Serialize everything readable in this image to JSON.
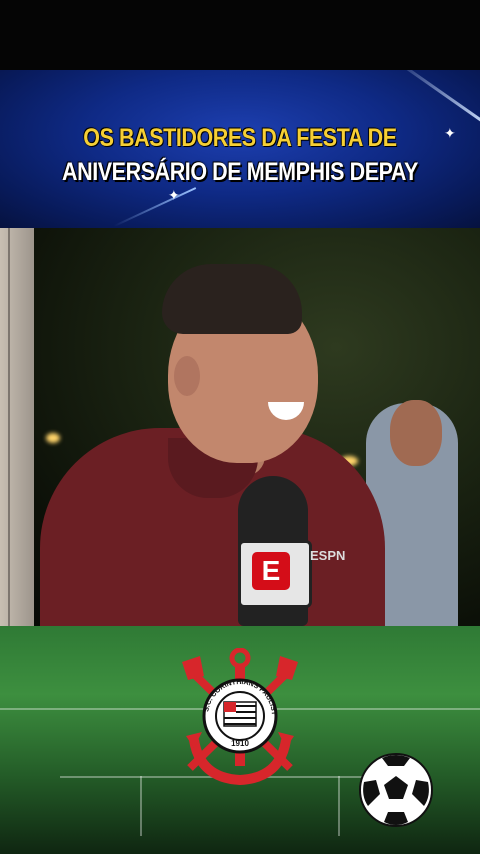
{
  "headline": {
    "line1": "OS BASTIDORES DA FESTA DE",
    "line2": "ANIVERSÁRIO DE MEMPHIS DEPAY"
  },
  "video": {
    "mic_logo_letter": "E",
    "shirt_brand": "ESPN"
  },
  "crest": {
    "ring_text": "S.C. CORINTHIANS PAULISTA",
    "year": "1910"
  },
  "colors": {
    "headline_line1": "#f6cf35",
    "headline_line2": "#ffffff",
    "band_blue": "#0f2a86",
    "field_green": "#3d8f3f",
    "crest_red": "#d7262b"
  }
}
